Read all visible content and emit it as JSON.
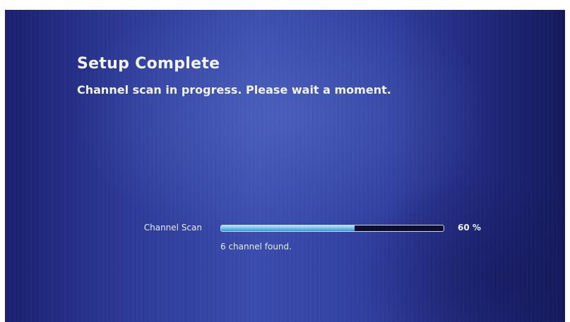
{
  "header": {
    "title": "Setup Complete",
    "subtitle": "Channel scan in progress. Please wait a moment."
  },
  "scan": {
    "label": "Channel Scan",
    "progress_percent": 60,
    "percent_text": "60 %",
    "status_text": "6 channel found."
  },
  "colors": {
    "background_blue": "#2d3a98",
    "progress_fill": "#6ec3f0",
    "progress_track": "#0b0e2a",
    "text": "#f2f4ff"
  }
}
